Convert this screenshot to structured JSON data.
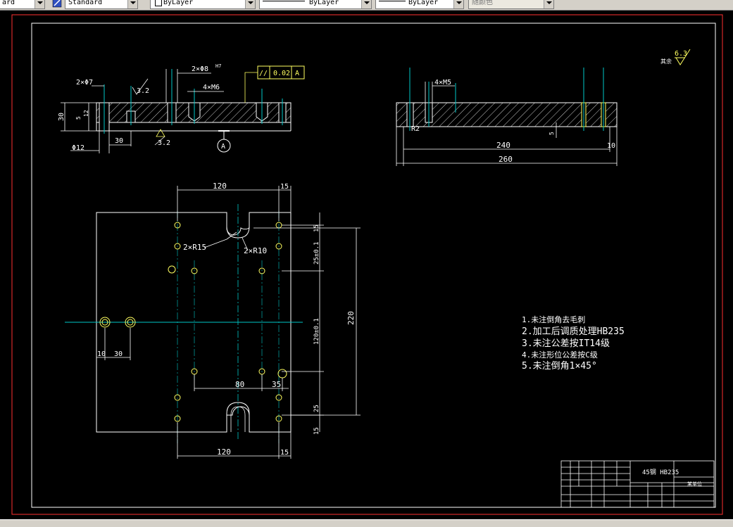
{
  "toolbar": {
    "style_combo_left": "ard",
    "dimstyle_combo": "Standard",
    "layer_combo": "ByLayer",
    "linetype_combo": "ByLayer",
    "lineweight_combo": "ByLayer",
    "color_combo": "随颜色"
  },
  "drawing": {
    "top_view": {
      "hole_callout_a": "2×Φ8",
      "hole_callout_a_sub": "H7",
      "hole_callout_b": "4×M6",
      "hole_callout_c": "2×Φ7",
      "roughness_top": "3.2",
      "roughness_bottom": "3.2",
      "gdt_symbol": "//",
      "gdt_value": "0.02",
      "gdt_datum": "A",
      "datum_label": "A",
      "dim_height": "30",
      "dim_slot": "5",
      "dim_slot_b": "12",
      "dim_dia": "Φ12",
      "dim_30": "30"
    },
    "side_view": {
      "hole_callout": "4×M5",
      "dim_r2": "R2",
      "dim_5": "5",
      "dim_240": "240",
      "dim_10": "10",
      "dim_260": "260"
    },
    "roughness_note": {
      "label": "其余",
      "value": "6.3"
    },
    "plan_view": {
      "dim_120_top": "120",
      "dim_15_top": "15",
      "dim_15_right_top": "15",
      "dim_25_right_top": "25±0.1",
      "dim_220": "220",
      "dim_120_right": "120±0.1",
      "dim_25_right_bottom": "25",
      "dim_15_right_bottom": "15",
      "dim_r15": "2×R15",
      "dim_r10": "2×R10",
      "dim_10": "10",
      "dim_30": "30",
      "dim_80": "80",
      "dim_35": "35",
      "dim_120_bottom": "120",
      "dim_15_bottom": "15"
    },
    "notes": {
      "items": [
        "1.未注倒角去毛刺",
        "2.加工后调质处理HB235",
        "3.未注公差按IT14级",
        "4.未注形位公差按C级",
        "5.未注倒角1×45°"
      ]
    },
    "title_block": {
      "material": "45钢 HB235",
      "company": "某单位"
    }
  },
  "colors": {
    "toolbar_bg": "#d4d0c8",
    "canvas_bg": "#000000",
    "outer_frame": "#ff3030",
    "drawing_lines": "#ffffff",
    "center_lines": "#00c8c8",
    "holes": "#ffff60",
    "gdt": "#ffff60"
  }
}
